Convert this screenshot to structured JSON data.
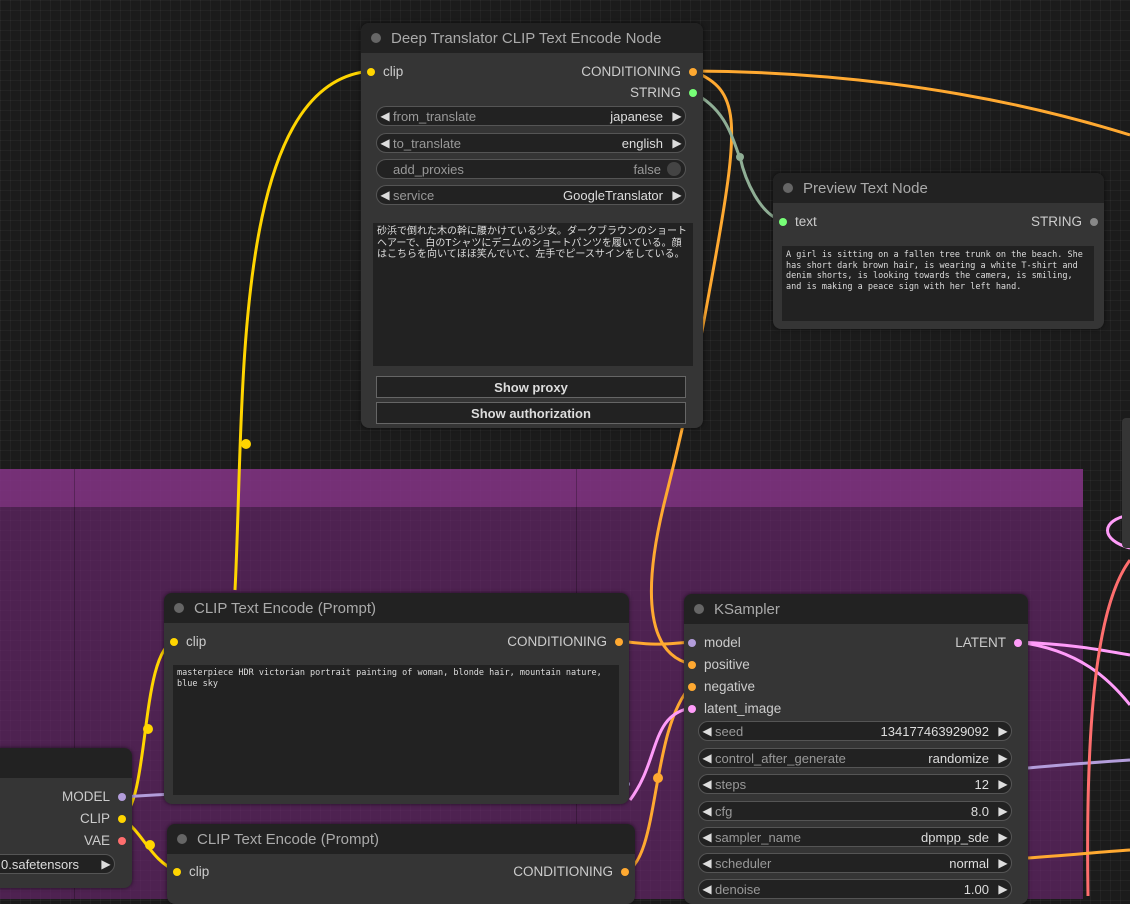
{
  "translator_node": {
    "title": "Deep Translator CLIP Text Encode Node",
    "input_clip": "clip",
    "output_conditioning": "CONDITIONING",
    "output_string": "STRING",
    "from_translate": {
      "label": "from_translate",
      "value": "japanese"
    },
    "to_translate": {
      "label": "to_translate",
      "value": "english"
    },
    "add_proxies": {
      "label": "add_proxies",
      "value": "false"
    },
    "service": {
      "label": "service",
      "value": "GoogleTranslator"
    },
    "text": "砂浜で倒れた木の幹に腰かけている少女。ダークブラウンのショートヘアーで、白のTシャツにデニムのショートパンツを履いている。顔はこちらを向いてほほ笑んでいて、左手でピースサインをしている。",
    "show_proxy_label": "Show proxy",
    "show_authorization_label": "Show authorization"
  },
  "preview_node": {
    "title": "Preview Text Node",
    "input_text": "text",
    "output_string": "STRING",
    "text": "A girl is sitting on a fallen tree trunk on the beach. She has short dark brown hair, is wearing a white T-shirt and denim shorts, is looking towards the camera, is smiling, and is making a peace sign with her left hand."
  },
  "clip_encode_1": {
    "title": "CLIP Text Encode (Prompt)",
    "input_clip": "clip",
    "output_conditioning": "CONDITIONING",
    "text": "masterpiece HDR victorian portrait painting of woman, blonde hair, mountain nature, blue sky"
  },
  "clip_encode_2": {
    "title": "CLIP Text Encode (Prompt)",
    "input_clip": "clip",
    "output_conditioning": "CONDITIONING"
  },
  "checkpoint_node": {
    "output_model": "MODEL",
    "output_clip": "CLIP",
    "output_vae": "VAE",
    "ckpt_value": "0.safetensors"
  },
  "ksampler": {
    "title": "KSampler",
    "input_model": "model",
    "input_positive": "positive",
    "input_negative": "negative",
    "input_latent": "latent_image",
    "output_latent": "LATENT",
    "seed": {
      "label": "seed",
      "value": "134177463929092"
    },
    "control_after_generate": {
      "label": "control_after_generate",
      "value": "randomize"
    },
    "steps": {
      "label": "steps",
      "value": "12"
    },
    "cfg": {
      "label": "cfg",
      "value": "8.0"
    },
    "sampler_name": {
      "label": "sampler_name",
      "value": "dpmpp_sde"
    },
    "scheduler": {
      "label": "scheduler",
      "value": "normal"
    },
    "denoise": {
      "label": "denoise",
      "value": "1.00"
    }
  },
  "colors": {
    "clip": "#ffd500",
    "conditioning": "#ffa931",
    "string": "#77ff77",
    "model": "#b39ddb",
    "vae": "#ff6e6e",
    "latent": "#ff9cf9",
    "group": "#78287d"
  }
}
